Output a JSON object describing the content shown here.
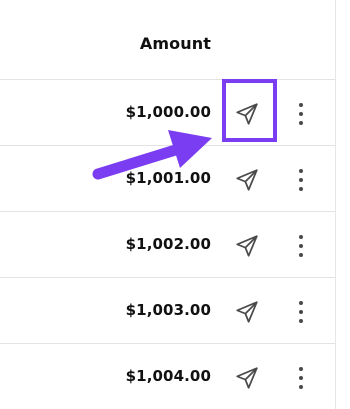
{
  "table": {
    "header": {
      "amount_label": "Amount"
    },
    "rows": [
      {
        "amount": "$1,000.00"
      },
      {
        "amount": "$1,001.00"
      },
      {
        "amount": "$1,002.00"
      },
      {
        "amount": "$1,003.00"
      },
      {
        "amount": "$1,004.00"
      }
    ]
  },
  "icons": {
    "send": "send-icon",
    "more": "more-vertical-icon"
  },
  "colors": {
    "highlight": "#7b3df2",
    "row_border": "#e3e3e3",
    "icon": "#4a4a4a"
  }
}
